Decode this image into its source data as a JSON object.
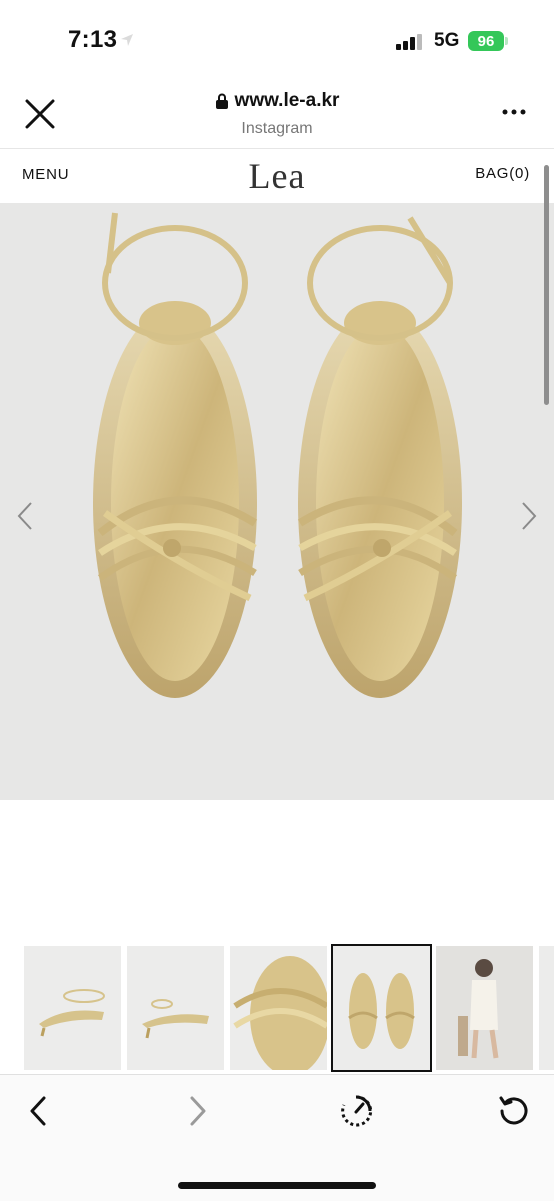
{
  "status_bar": {
    "time": "7:13",
    "network": "5G",
    "battery": "96"
  },
  "browser": {
    "url": "www.le-a.kr",
    "subtitle": "Instagram"
  },
  "site": {
    "menu_label": "MENU",
    "logo": "Lea",
    "bag_label": "BAG(0)"
  },
  "product": {
    "image": "gold-strappy-sandals",
    "thumbnail_count": 6,
    "active_thumbnail": 4
  },
  "colors": {
    "battery": "#34c759",
    "hero_bg": "#e7e7e6",
    "gold": "#d9c58e"
  }
}
